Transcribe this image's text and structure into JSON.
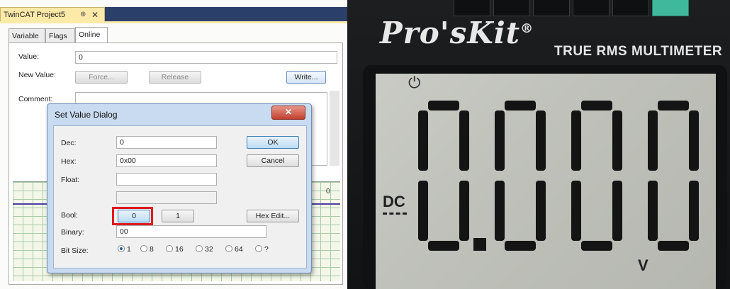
{
  "twincat": {
    "doc_tab": {
      "title": "TwinCAT Project5",
      "pin": "⊕",
      "close": "✕"
    },
    "tabs": [
      {
        "label": "Variable",
        "active": false
      },
      {
        "label": "Flags",
        "active": false
      },
      {
        "label": "Online",
        "active": true
      }
    ],
    "online": {
      "value_label": "Value:",
      "value": "0",
      "new_value_label": "New Value:",
      "force_label": "Force...",
      "release_label": "Release",
      "write_label": "Write...",
      "comment_label": "Comment:",
      "chart_marker": "0"
    },
    "dialog": {
      "title": "Set Value Dialog",
      "close": "✕",
      "dec_label": "Dec:",
      "dec_value": "0",
      "hex_label": "Hex:",
      "hex_value": "0x00",
      "float_label": "Float:",
      "float_value": "",
      "bool_label": "Bool:",
      "bool_false": "0",
      "bool_true": "1",
      "binary_label": "Binary:",
      "binary_value": "00",
      "bitsize_label": "Bit Size:",
      "bitsize_options": [
        "1",
        "8",
        "16",
        "32",
        "64",
        "?"
      ],
      "bitsize_selected": "1",
      "ok_label": "OK",
      "cancel_label": "Cancel",
      "hexedit_label": "Hex Edit..."
    }
  },
  "multimeter": {
    "brand": "Pro'sKit",
    "brand_reg": "®",
    "subtitle": "TRUE RMS  MULTIMETER",
    "power_symbol": "⏻",
    "mode": "DC",
    "reading": "0.000",
    "unit": "V"
  },
  "colors": {
    "highlight": "#e0191e",
    "lcd": "#c3c5be",
    "segment": "#141414"
  }
}
